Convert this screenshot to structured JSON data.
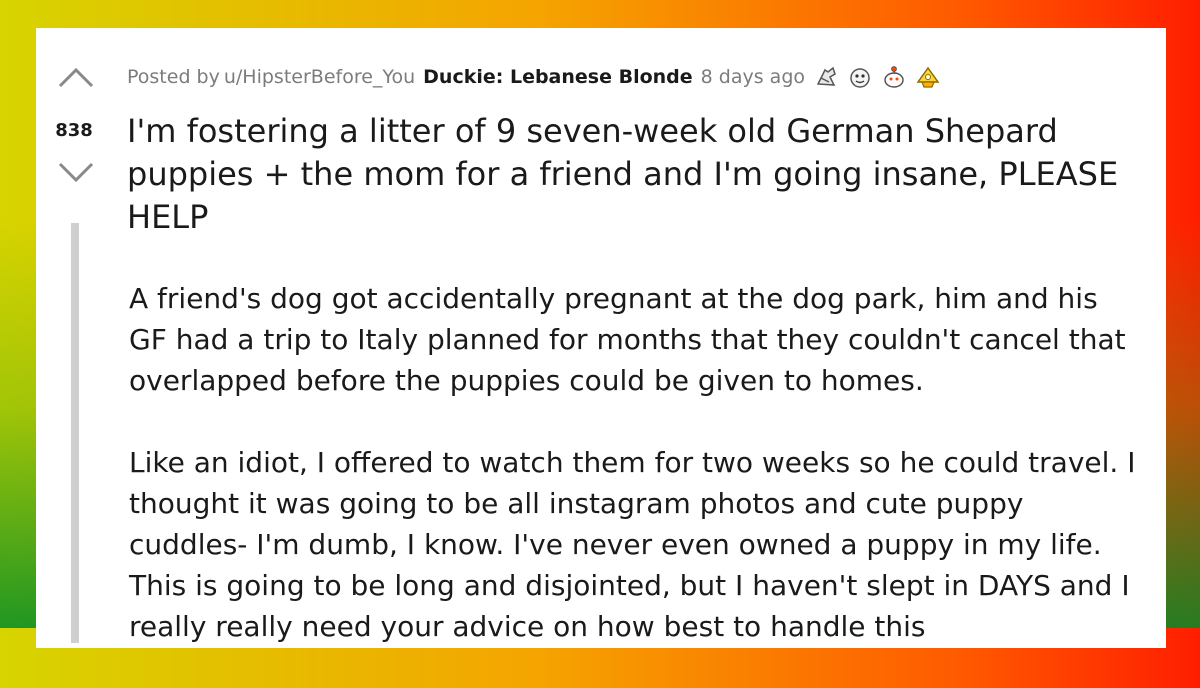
{
  "post": {
    "score": "838",
    "posted_by_prefix": "Posted by",
    "author": "u/HipsterBefore_You",
    "flair": "Duckie: Lebanese Blonde",
    "age": "8 days ago",
    "awards": [
      "award-icon-1",
      "award-icon-2",
      "award-icon-3",
      "award-icon-4"
    ],
    "title": "I'm fostering a litter of 9 seven-week old German Shepard puppies + the mom for a friend and I'm going insane, PLEASE HELP",
    "paragraphs": [
      "A friend's dog got accidentally pregnant at the dog park, him and his GF had a trip to Italy planned for months that they couldn't cancel that overlapped before the puppies could be given to homes.",
      "Like an idiot, I offered to watch them for two weeks so he could travel. I thought it was going to be all instagram photos and cute puppy cuddles- I'm dumb, I know. I've never even owned a puppy in my life. This is going to be long and disjointed, but I haven't slept in DAYS and I really really need your advice on how best to handle this"
    ]
  },
  "colors": {
    "text": "#1a1a1b",
    "meta": "#7c7c7c",
    "thread_line": "#cfcfcf"
  }
}
